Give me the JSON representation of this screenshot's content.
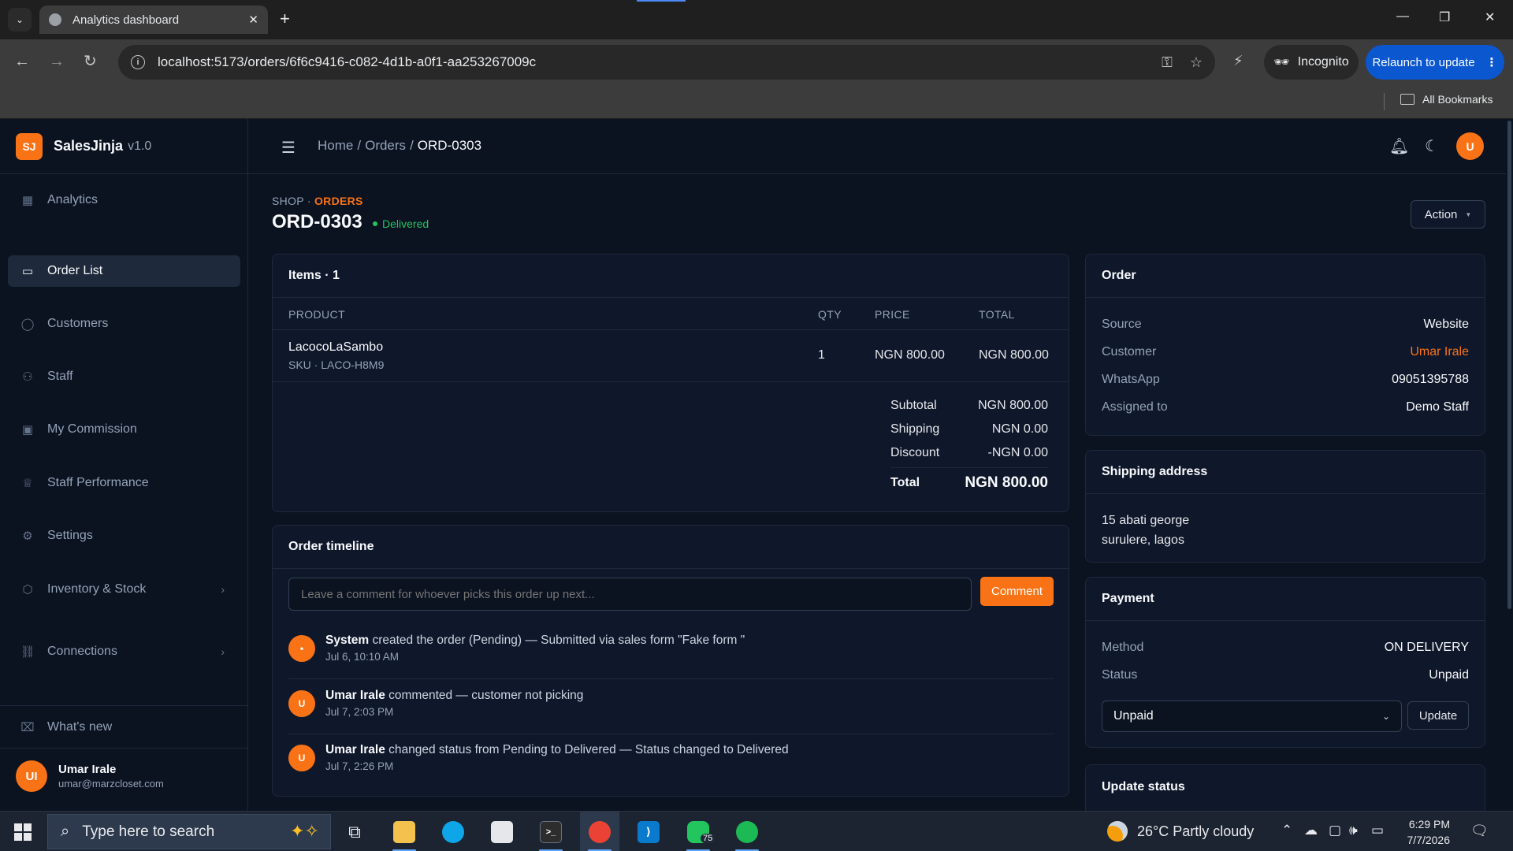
{
  "browser": {
    "tab_title": "Analytics dashboard",
    "url": "localhost:5173/orders/6f6c9416-c082-4d1b-a0f1-aa253267009c",
    "incognito_label": "Incognito",
    "relaunch_label": "Relaunch to update",
    "all_bookmarks": "All Bookmarks"
  },
  "brand": {
    "logo": "SJ",
    "name": "SalesJinja",
    "version": "v1.0"
  },
  "sidebar": {
    "items": [
      {
        "label": "Analytics",
        "icon": "grid-icon"
      },
      {
        "label": "Order List",
        "icon": "clipboard-icon",
        "active": true
      },
      {
        "label": "Customers",
        "icon": "user-icon"
      },
      {
        "label": "Staff",
        "icon": "users-icon"
      },
      {
        "label": "My Commission",
        "icon": "wallet-icon"
      },
      {
        "label": "Staff Performance",
        "icon": "trophy-icon"
      },
      {
        "label": "Settings",
        "icon": "gear-icon"
      },
      {
        "label": "Inventory & Stock",
        "icon": "box-icon"
      },
      {
        "label": "Connections",
        "icon": "link-icon"
      }
    ],
    "whats_new": "What's new",
    "user": {
      "initials": "UI",
      "name": "Umar Irale",
      "email": "umar@marzcloset.com"
    }
  },
  "topbar": {
    "breadcrumb": [
      "Home",
      "Orders",
      "ORD-0303"
    ],
    "avatar": "U"
  },
  "header": {
    "eyebrow_shop": "SHOP",
    "eyebrow_sep": " · ",
    "eyebrow_orders": "ORDERS",
    "order_id": "ORD-0303",
    "status": "Delivered",
    "action_label": "Action"
  },
  "items": {
    "title": "Items · 1",
    "columns": [
      "PRODUCT",
      "QTY",
      "PRICE",
      "TOTAL"
    ],
    "rows": [
      {
        "product": "LacocoLaSambo",
        "sku": "SKU · LACO-H8M9",
        "qty": "1",
        "price": "NGN 800.00",
        "total": "NGN 800.00"
      }
    ],
    "summary": {
      "subtotal_label": "Subtotal",
      "subtotal": "NGN 800.00",
      "shipping_label": "Shipping",
      "shipping": "NGN 0.00",
      "discount_label": "Discount",
      "discount": "-NGN 0.00",
      "total_label": "Total",
      "total": "NGN 800.00"
    }
  },
  "timeline": {
    "title": "Order timeline",
    "placeholder": "Leave a comment for whoever picks this order up next...",
    "comment_label": "Comment",
    "events": [
      {
        "avatar": "•",
        "actor": "System",
        "text": " created the order (Pending) — Submitted via sales form \"Fake form \"",
        "time": "Jul 6, 10:10 AM"
      },
      {
        "avatar": "U",
        "actor": "Umar Irale",
        "text": " commented — customer not picking",
        "time": "Jul 7, 2:03 PM"
      },
      {
        "avatar": "U",
        "actor": "Umar Irale",
        "text": " changed status from Pending to Delivered — Status changed to Delivered",
        "time": "Jul 7, 2:26 PM"
      }
    ]
  },
  "order_info": {
    "title": "Order",
    "rows": [
      {
        "label": "Source",
        "value": "Website"
      },
      {
        "label": "Customer",
        "value": "Umar Irale"
      },
      {
        "label": "WhatsApp",
        "value": "09051395788"
      },
      {
        "label": "Assigned to",
        "value": "Demo Staff"
      }
    ]
  },
  "shipping": {
    "title": "Shipping address",
    "line1": "15 abati george",
    "line2": "surulere, lagos"
  },
  "payment": {
    "title": "Payment",
    "method_label": "Method",
    "method": "ON DELIVERY",
    "status_label": "Status",
    "status": "Unpaid",
    "select_value": "Unpaid",
    "update_label": "Update"
  },
  "update_status": {
    "title": "Update status"
  },
  "taskbar": {
    "search_placeholder": "Type here to search",
    "whatsapp_badge": "75",
    "weather": "26°C  Partly cloudy",
    "time": "6:29 PM",
    "date": "7/7/2026"
  }
}
